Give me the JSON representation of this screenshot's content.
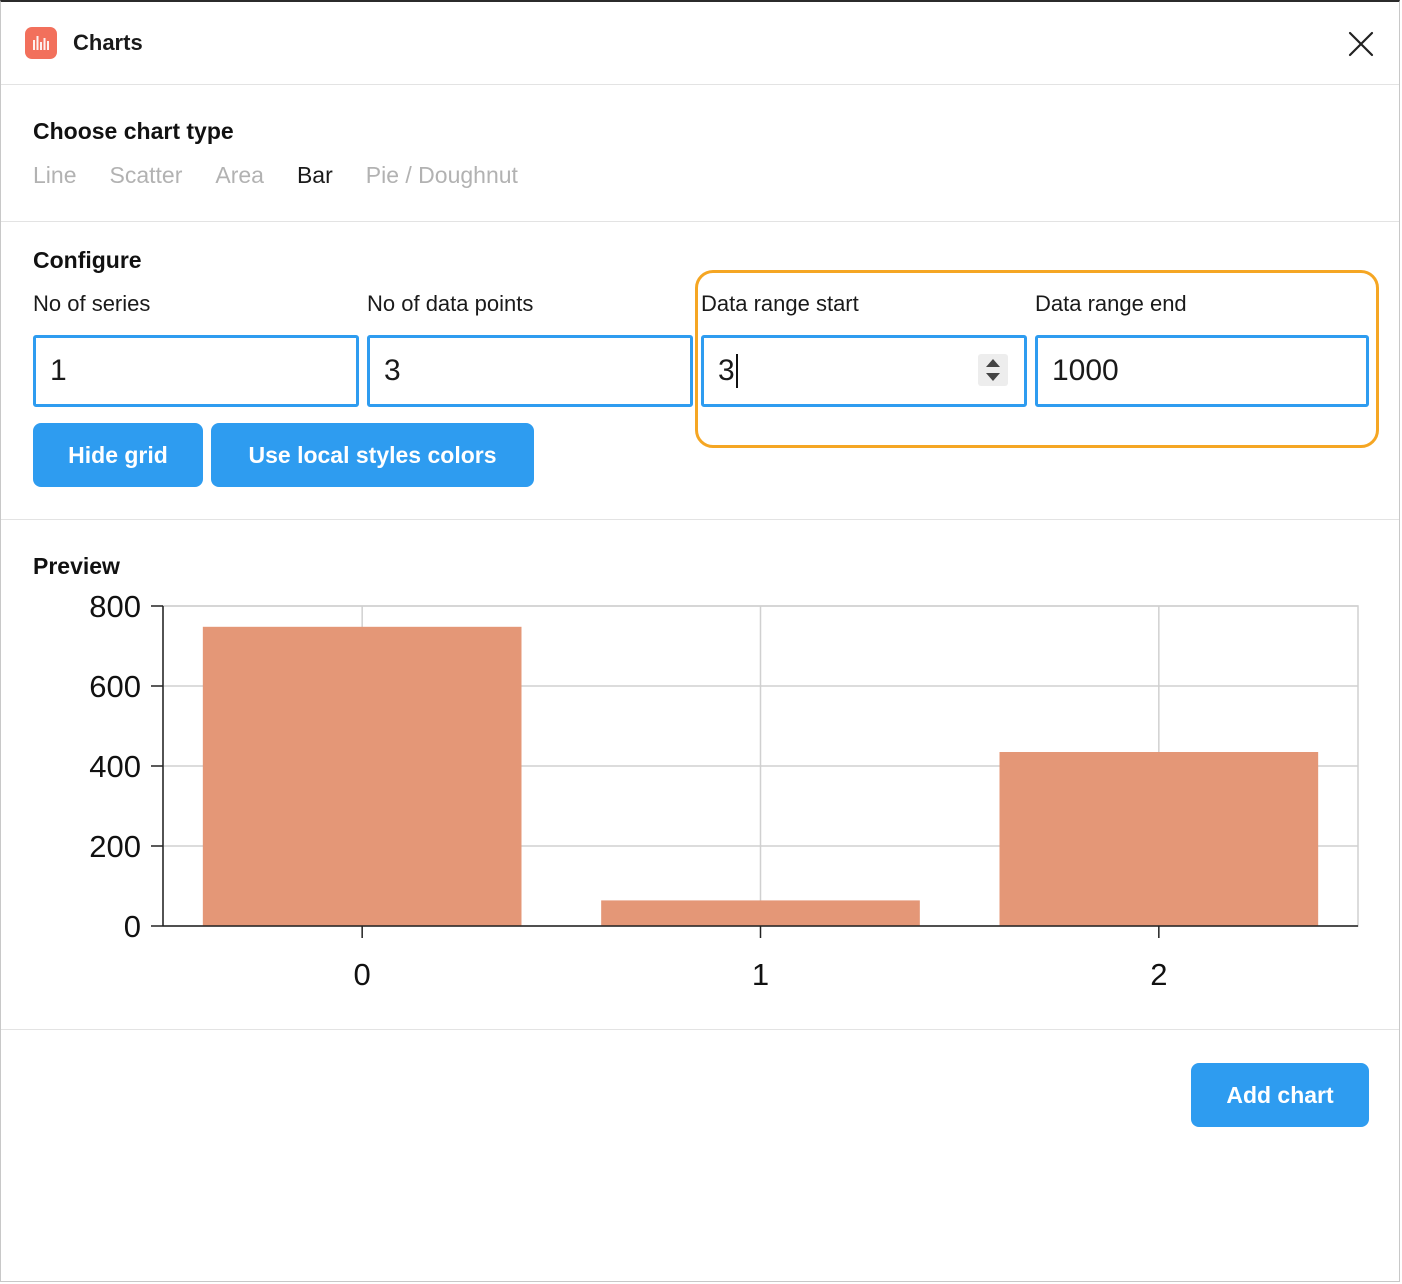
{
  "window": {
    "title": "Charts",
    "icon": "bar-chart-icon",
    "close_icon": "close-icon"
  },
  "chart_type_section": {
    "title": "Choose chart type",
    "types": [
      {
        "label": "Line",
        "active": false
      },
      {
        "label": "Scatter",
        "active": false
      },
      {
        "label": "Area",
        "active": false
      },
      {
        "label": "Bar",
        "active": true
      },
      {
        "label": "Pie / Doughnut",
        "active": false
      }
    ]
  },
  "configure": {
    "title": "Configure",
    "fields": {
      "series": {
        "label": "No of series",
        "value": "1"
      },
      "points": {
        "label": "No of data points",
        "value": "3"
      },
      "range_start": {
        "label": "Data range start",
        "value": "3"
      },
      "range_end": {
        "label": "Data range end",
        "value": "1000"
      }
    },
    "buttons": {
      "hide_grid": "Hide grid",
      "local_styles": "Use local styles colors"
    },
    "highlight_color": "#f5a623"
  },
  "preview": {
    "title": "Preview"
  },
  "chart_data": {
    "type": "bar",
    "categories": [
      "0",
      "1",
      "2"
    ],
    "series": [
      {
        "values": [
          748,
          64,
          435
        ],
        "color": "#e49777"
      }
    ],
    "ylim": [
      0,
      800
    ],
    "yticks": [
      0,
      200,
      400,
      600,
      800
    ],
    "grid": true
  },
  "footer": {
    "add_chart": "Add chart"
  },
  "colors": {
    "accent": "#2e9cf0",
    "app_icon": "#f2705c"
  }
}
